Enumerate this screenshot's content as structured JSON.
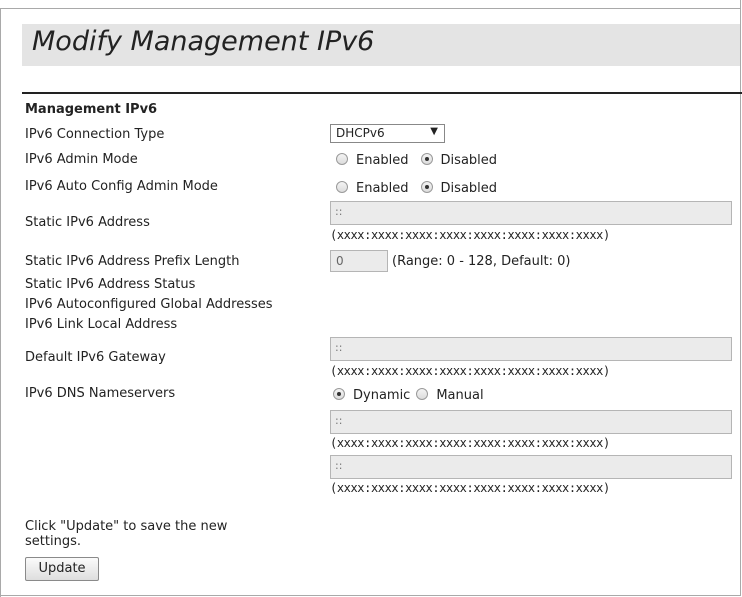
{
  "page": {
    "title": "Modify Management IPv6",
    "section_heading": "Management IPv6"
  },
  "fields": {
    "connection_type": {
      "label": "IPv6 Connection Type",
      "value": "DHCPv6"
    },
    "admin_mode": {
      "label": "IPv6 Admin Mode",
      "option_enabled": "Enabled",
      "option_disabled": "Disabled",
      "selected": "Disabled"
    },
    "auto_config": {
      "label": "IPv6 Auto Config Admin Mode",
      "option_enabled": "Enabled",
      "option_disabled": "Disabled",
      "selected": "Disabled"
    },
    "static_address": {
      "label": "Static IPv6 Address",
      "value": "::",
      "hint": "(xxxx:xxxx:xxxx:xxxx:xxxx:xxxx:xxxx:xxxx)"
    },
    "prefix_length": {
      "label": "Static IPv6 Address Prefix Length",
      "value": "0",
      "range": "(Range: 0 - 128, Default: 0)"
    },
    "address_status": {
      "label": "Static IPv6 Address Status"
    },
    "autoconf_global": {
      "label": "IPv6 Autoconfigured Global Addresses"
    },
    "link_local": {
      "label": "IPv6 Link Local Address"
    },
    "gateway": {
      "label": "Default IPv6 Gateway",
      "value": "::",
      "hint": "(xxxx:xxxx:xxxx:xxxx:xxxx:xxxx:xxxx:xxxx)"
    },
    "dns": {
      "label": "IPv6 DNS Nameservers",
      "option_dynamic": "Dynamic",
      "option_manual": "Manual",
      "selected": "Dynamic",
      "server1": {
        "value": "::",
        "hint": "(xxxx:xxxx:xxxx:xxxx:xxxx:xxxx:xxxx:xxxx)"
      },
      "server2": {
        "value": "::",
        "hint": "(xxxx:xxxx:xxxx:xxxx:xxxx:xxxx:xxxx:xxxx)"
      }
    }
  },
  "footer": {
    "instruction": "Click \"Update\" to save the new settings.",
    "update_label": "Update"
  }
}
